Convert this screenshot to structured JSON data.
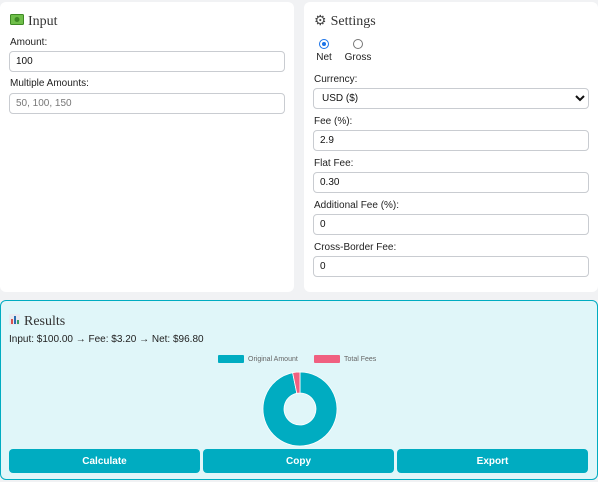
{
  "input": {
    "title": "Input",
    "icon": "money-icon",
    "amount_label": "Amount:",
    "amount_value": "100",
    "multiple_label": "Multiple Amounts:",
    "multiple_placeholder": "50, 100, 150"
  },
  "settings": {
    "title": "Settings",
    "icon": "gear-icon",
    "mode_options": [
      {
        "label": "Net",
        "checked": true
      },
      {
        "label": "Gross",
        "checked": false
      }
    ],
    "currency_label": "Currency:",
    "currency_value": "USD ($)",
    "fee_pct_label": "Fee (%):",
    "fee_pct_value": "2.9",
    "flat_fee_label": "Flat Fee:",
    "flat_fee_value": "0.30",
    "additional_fee_label": "Additional Fee (%):",
    "additional_fee_value": "0",
    "cross_border_label": "Cross-Border Fee:",
    "cross_border_value": "0"
  },
  "results": {
    "title": "Results",
    "icon": "bar-chart-icon",
    "summary": "Input: $100.00 → Fee: $3.20 → Net: $96.80"
  },
  "chart_data": {
    "type": "pie",
    "labels": [
      "Original Amount",
      "Total Fees"
    ],
    "values": [
      96.8,
      3.2
    ],
    "colors": [
      "#00acc1",
      "#f06080"
    ],
    "legend": "top"
  },
  "buttons": {
    "calculate": "Calculate",
    "copy": "Copy",
    "export": "Export"
  },
  "colors": {
    "accent": "#00acc1",
    "results_bg": "#e0f6f9"
  }
}
